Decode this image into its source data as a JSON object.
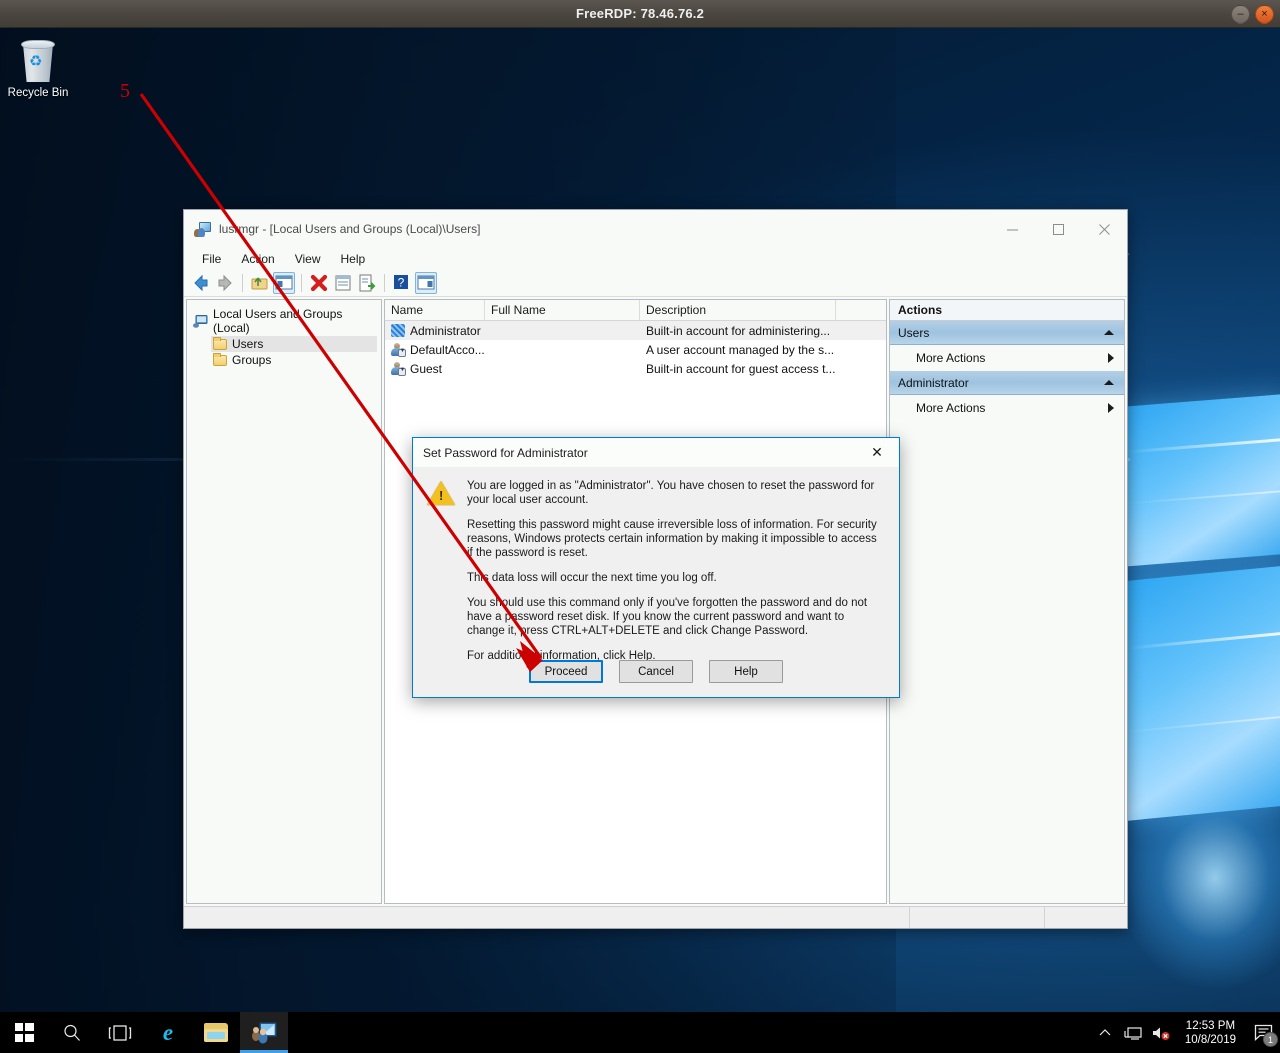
{
  "rdp_window": {
    "title": "FreeRDP: 78.46.76.2",
    "minimize_label": "–",
    "close_label": "×"
  },
  "desktop": {
    "icons": [
      {
        "name": "Recycle Bin",
        "icon": "recycle-bin-icon"
      }
    ],
    "annotation": {
      "number": "5",
      "color": "#cc0000"
    }
  },
  "mmc_window": {
    "title": "lusrmgr - [Local Users and Groups (Local)\\Users]",
    "icon": "local-users-and-groups-icon",
    "window_buttons": {
      "minimize": "—",
      "maximize": "□",
      "close": "✕"
    },
    "menu": [
      "File",
      "Action",
      "View",
      "Help"
    ],
    "toolbar": [
      "back-icon",
      "forward-icon",
      "separator",
      "up-folder-icon",
      "show-hide-tree-icon",
      "separator",
      "delete-icon",
      "properties-icon",
      "export-list-icon",
      "separator",
      "help-icon",
      "show-action-pane-icon"
    ],
    "tree": {
      "root": {
        "label": "Local Users and Groups (Local)",
        "icon": "computer-icon"
      },
      "children": [
        {
          "label": "Users",
          "icon": "folder-icon",
          "selected": true
        },
        {
          "label": "Groups",
          "icon": "folder-icon",
          "selected": false
        }
      ]
    },
    "list": {
      "columns": [
        "Name",
        "Full Name",
        "Description",
        ""
      ],
      "rows": [
        {
          "name": "Administrator",
          "full_name": "",
          "description": "Built-in account for administering...",
          "icon": "administrator-user-icon",
          "selected": true
        },
        {
          "name": "DefaultAcco...",
          "full_name": "",
          "description": "A user account managed by the s...",
          "icon": "disabled-user-icon",
          "selected": false
        },
        {
          "name": "Guest",
          "full_name": "",
          "description": "Built-in account for guest access t...",
          "icon": "disabled-user-icon",
          "selected": false
        }
      ]
    },
    "actions_pane": {
      "title": "Actions",
      "groups": [
        {
          "label": "Users",
          "collapse_icon": "caret-up-icon",
          "items": [
            {
              "label": "More Actions",
              "submenu_icon": "caret-right-icon"
            }
          ]
        },
        {
          "label": "Administrator",
          "collapse_icon": "caret-up-icon",
          "items": [
            {
              "label": "More Actions",
              "submenu_icon": "caret-right-icon"
            }
          ]
        }
      ]
    },
    "status_bar": {
      "left": "",
      "middle": "",
      "right": ""
    }
  },
  "dialog": {
    "title": "Set Password for Administrator",
    "close_label": "✕",
    "warning_icon": "warning-triangle-icon",
    "paragraphs": [
      "You are logged in as \"Administrator\". You have chosen to reset the password for your local user account.",
      "Resetting this password might cause irreversible loss of information. For security reasons, Windows protects certain information by making it impossible to access if the password is reset.",
      "This data loss will occur the next time you log off.",
      "You should use this command only if you've forgotten the password and do not have a password reset disk. If you know the current password and want to change it, press CTRL+ALT+DELETE and click Change Password.",
      "For additional information, click Help."
    ],
    "buttons": [
      {
        "label": "Proceed",
        "default": true
      },
      {
        "label": "Cancel",
        "default": false
      },
      {
        "label": "Help",
        "default": false
      }
    ]
  },
  "taskbar": {
    "start_icon": "windows-start-icon",
    "items": [
      {
        "name": "search-icon",
        "label": ""
      },
      {
        "name": "task-view-icon",
        "label": ""
      },
      {
        "name": "internet-explorer-icon",
        "label": ""
      },
      {
        "name": "file-explorer-icon",
        "label": ""
      },
      {
        "name": "lusrmgr-taskbar-icon",
        "label": "",
        "active": true
      }
    ],
    "tray": {
      "show_hidden_icon": "chevron-up-icon",
      "network_icon": "network-icon",
      "volume_icon": "volume-muted-icon",
      "time": "12:53 PM",
      "date": "10/8/2019",
      "notification_icon": "action-center-icon",
      "notification_count": "1"
    }
  }
}
